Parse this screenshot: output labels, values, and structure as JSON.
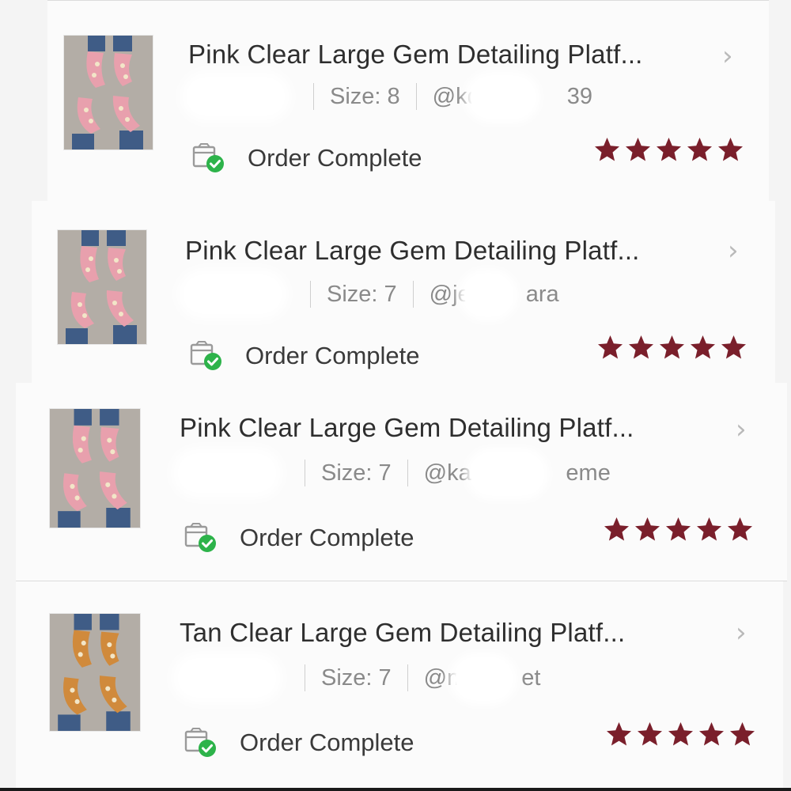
{
  "orders": [
    {
      "title": "Pink Clear Large Gem Detailing Platf...",
      "size": "Size: 8",
      "user_left": "@kd",
      "user_right": "39",
      "status": "Order Complete",
      "rating": 5,
      "color": "pink"
    },
    {
      "title": "Pink Clear Large Gem Detailing Platf...",
      "size": "Size: 7",
      "user_left": "@je",
      "user_right": "ara",
      "status": "Order Complete",
      "rating": 5,
      "color": "pink"
    },
    {
      "title": "Pink Clear Large Gem Detailing Platf...",
      "size": "Size: 7",
      "user_left": "@kar",
      "user_right": "eme",
      "status": "Order Complete",
      "rating": 5,
      "color": "pink"
    },
    {
      "title": "Tan Clear Large Gem Detailing Platf...",
      "size": "Size: 7",
      "user_left": "@m",
      "user_right": "et",
      "status": "Order Complete",
      "rating": 5,
      "color": "tan"
    }
  ],
  "colors": {
    "star": "#7a1f2b",
    "check": "#2db34a",
    "pink_shoe": "#e8a0ad",
    "tan_shoe": "#d08a3c"
  },
  "icons": {
    "chevron": "chevron-right-icon",
    "status": "order-complete-icon",
    "rating": "star-icon"
  }
}
